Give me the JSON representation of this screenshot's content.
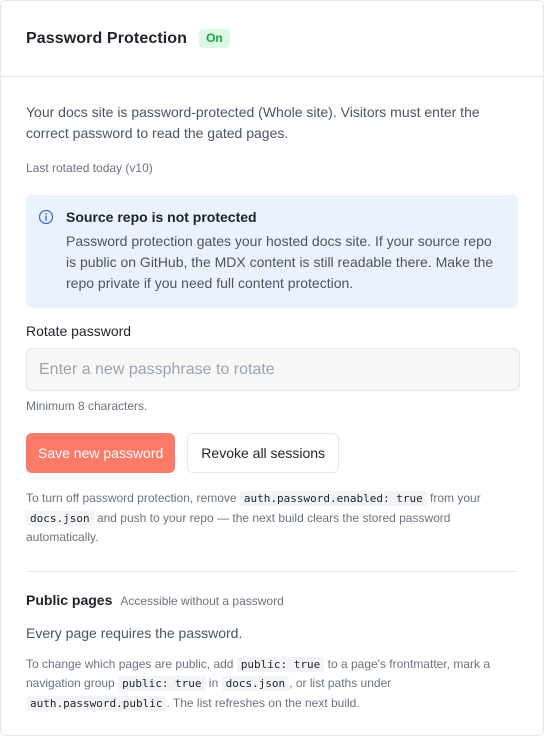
{
  "header": {
    "title": "Password Protection",
    "status": "On"
  },
  "description": "Your docs site is password-protected (Whole site). Visitors must enter the correct password to read the gated pages.",
  "last_rotated": "Last rotated today (v10)",
  "notice": {
    "icon": "info-icon",
    "title": "Source repo is not protected",
    "text": "Password protection gates your hosted docs site. If your source repo is public on GitHub, the MDX content is still readable there. Make the repo private if you need full content protection."
  },
  "rotate": {
    "label": "Rotate password",
    "value": "",
    "placeholder": "Enter a new passphrase to rotate",
    "hint": "Minimum 8 characters."
  },
  "actions": {
    "save_label": "Save new password",
    "revoke_label": "Revoke all sessions"
  },
  "turn_off": {
    "t1": "To turn off password protection, remove ",
    "code1": "auth.password.enabled: true",
    "t2": " from your ",
    "code2": "docs.json",
    "t3": " and push to your repo — the next build clears the stored password automatically."
  },
  "public_pages": {
    "title": "Public pages",
    "subtitle": "Accessible without a password",
    "text": "Every page requires the password.",
    "change": {
      "t1": "To change which pages are public, add ",
      "code1": "public: true",
      "t2": " to a page's frontmatter, mark a navigation group ",
      "code2": "public: true",
      "t3": " in ",
      "code3": "docs.json",
      "t4": ", or list paths under ",
      "code4": "auth.password.public",
      "t5": ". The list refreshes on the next build."
    }
  },
  "colors": {
    "accent": "#fb7a68",
    "status_on_bg": "#ddf7e6",
    "status_on_text": "#16a34a",
    "notice_bg": "#eaf2fd"
  }
}
